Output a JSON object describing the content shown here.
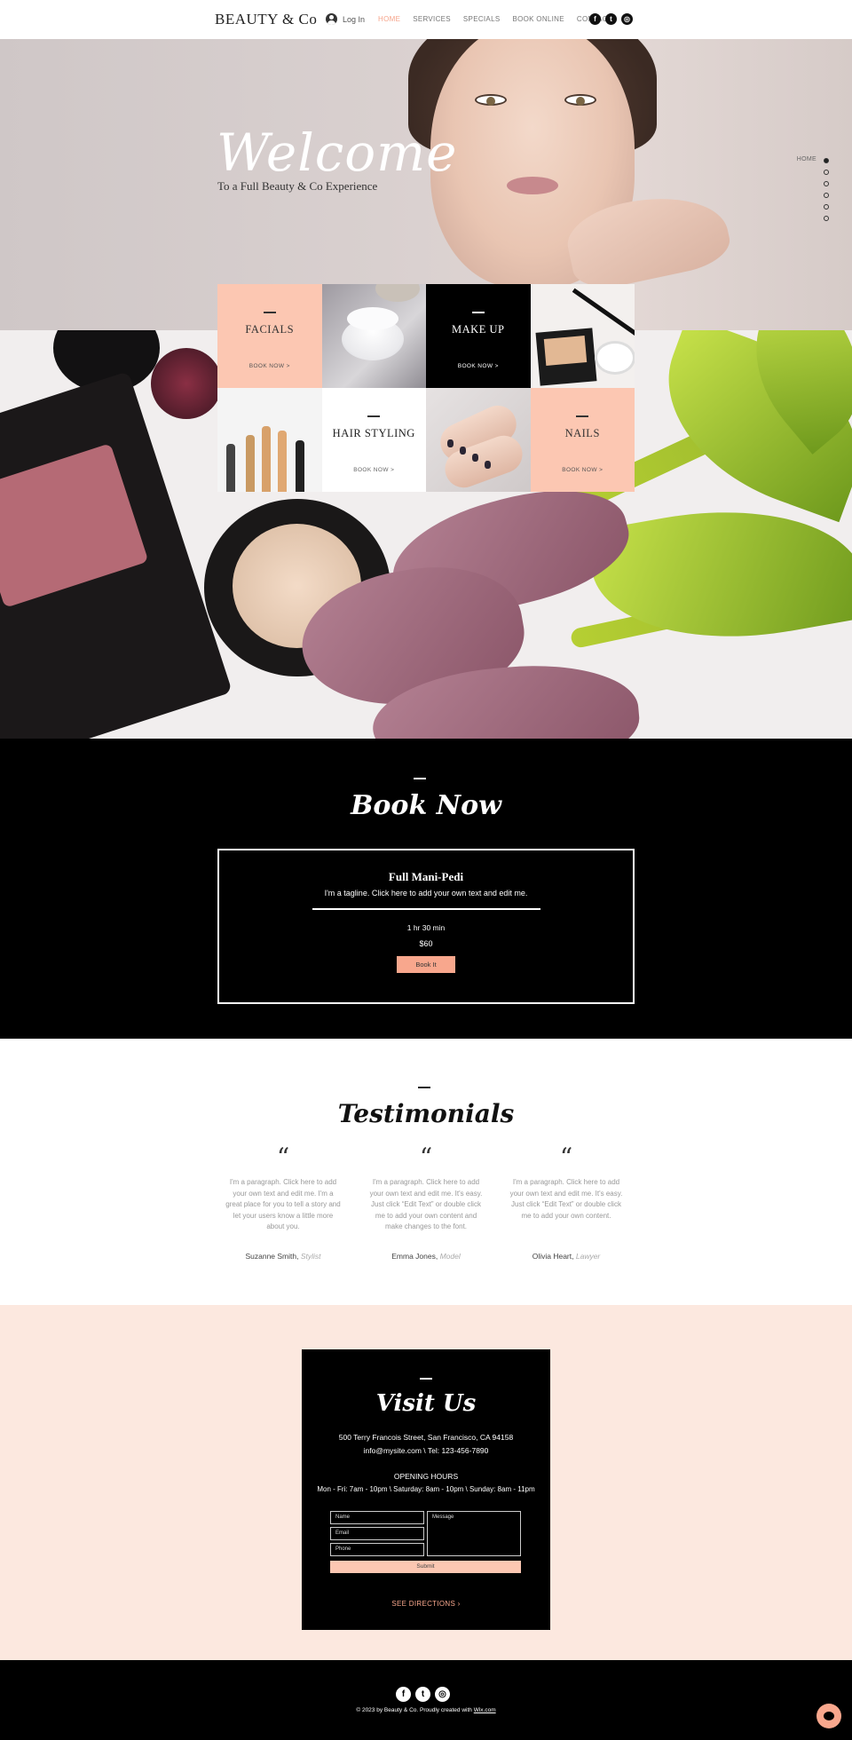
{
  "header": {
    "logo": "BEAUTY & Co",
    "login_label": "Log In",
    "nav": [
      "HOME",
      "SERVICES",
      "SPECIALS",
      "BOOK ONLINE",
      "CONTACT"
    ],
    "active_nav": "HOME",
    "social_icons": [
      "facebook-icon",
      "twitter-icon",
      "instagram-icon"
    ]
  },
  "hero": {
    "title": "Welcome",
    "subtitle": "To a Full Beauty & Co Experience",
    "dotnav_label": "HOME",
    "dotnav_count": 6
  },
  "services": {
    "facials": {
      "title": "FACIALS",
      "cta": "BOOK NOW >"
    },
    "makeup": {
      "title": "MAKE UP",
      "cta": "BOOK NOW >"
    },
    "hair": {
      "title": "HAIR STYLING",
      "cta": "BOOK NOW >"
    },
    "nails": {
      "title": "NAILS",
      "cta": "BOOK NOW >"
    }
  },
  "book": {
    "heading": "Book Now",
    "service_title": "Full Mani-Pedi",
    "tagline": "I'm a tagline. Click here to add your own text and edit me.",
    "duration": "1 hr 30 min",
    "price": "$60",
    "button": "Book It"
  },
  "testimonials": {
    "heading": "Testimonials",
    "items": [
      {
        "quote_mark": "“",
        "text": "I'm a paragraph. Click here to add your own text and edit me. I'm a great place for you to tell a story and let your users know a little more about you.",
        "name": "Suzanne Smith,",
        "role": "Stylist"
      },
      {
        "quote_mark": "“",
        "text": "I'm a paragraph. Click here to add your own text and edit me. It's easy. Just click “Edit Text” or double click me to add your own content and make changes to the font.",
        "name": "Emma Jones,",
        "role": "Model"
      },
      {
        "quote_mark": "“",
        "text": "I'm a paragraph. Click here to add your own text and edit me. It's easy. Just click “Edit Text” or double click me to add your own content.",
        "name": "Olivia Heart,",
        "role": "Lawyer"
      }
    ]
  },
  "visit": {
    "heading": "Visit Us",
    "address": "500 Terry Francois Street, San Francisco, CA 94158",
    "contact": "info@mysite.com  \\  Tel: 123-456-7890",
    "hours_title": "OPENING HOURS",
    "hours": "Mon - Fri: 7am - 10pm  \\  Saturday: 8am - 10pm  \\  Sunday: 8am - 11pm",
    "form": {
      "name_placeholder": "Name",
      "email_placeholder": "Email",
      "phone_placeholder": "Phone",
      "message_placeholder": "Message",
      "submit": "Submit"
    },
    "directions": "SEE DIRECTIONS"
  },
  "footer": {
    "copyright": "© 2023 by Beauty & Co. Proudly created with",
    "wix_link": "Wix.com",
    "social_icons": [
      "facebook-icon",
      "twitter-icon",
      "instagram-icon"
    ]
  },
  "colors": {
    "accent": "#f8a78d",
    "peach": "#fcc7b2",
    "visit_bg": "#fce8df",
    "black": "#000000"
  }
}
